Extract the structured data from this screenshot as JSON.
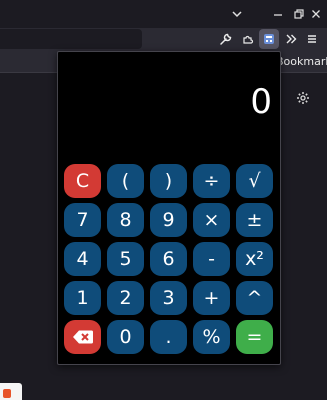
{
  "browser": {
    "bookmarks_label": "Bookmarks"
  },
  "calculator": {
    "display": "0",
    "keys": {
      "clear": "C",
      "paren_open": "(",
      "paren_close": ")",
      "divide": "÷",
      "sqrt": "√",
      "seven": "7",
      "eight": "8",
      "nine": "9",
      "multiply": "×",
      "plus_minus": "±",
      "four": "4",
      "five": "5",
      "six": "6",
      "minus": "-",
      "square": "x²",
      "one": "1",
      "two": "2",
      "three": "3",
      "plus": "+",
      "power": "^",
      "zero": "0",
      "dot": ".",
      "percent": "%",
      "equals": "="
    },
    "colors": {
      "key": "#0f4c7a",
      "clear": "#d33a34",
      "backspace": "#d33a34",
      "equals": "#3fae4a",
      "background": "#000000"
    }
  },
  "icons": [
    "chevron-down-icon",
    "restore-icon",
    "close-icon",
    "wrench-icon",
    "extensions-icon",
    "calculator-extension-icon",
    "overflow-chevron-icon",
    "menu-icon",
    "gear-icon",
    "backspace-icon"
  ]
}
